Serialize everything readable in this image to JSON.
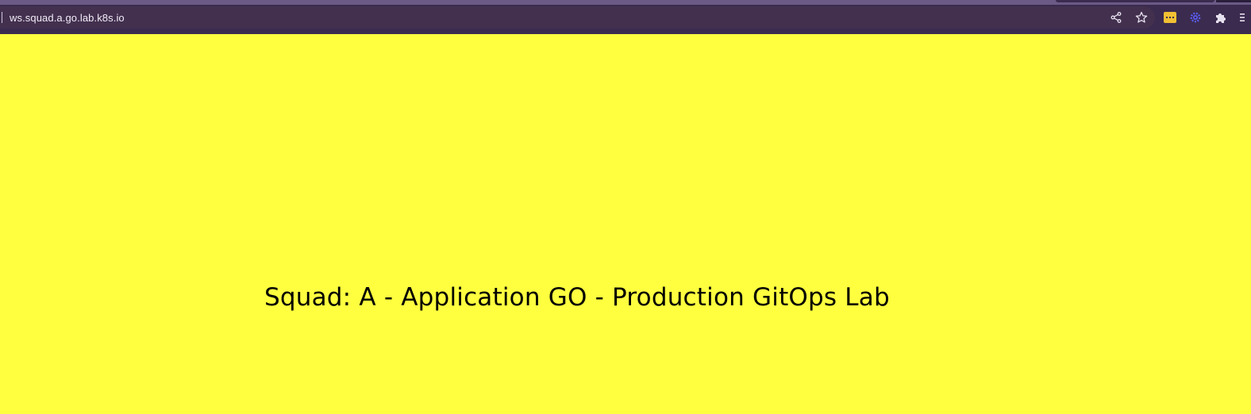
{
  "browser": {
    "url": "ws.squad.a.go.lab.k8s.io",
    "omnibox_icons": [
      "share-icon",
      "bookmark-star-icon"
    ],
    "extension_icons": [
      "password-manager-extension-icon",
      "gear-extension-icon",
      "extensions-puzzle-icon",
      "menu-icon"
    ],
    "colors": {
      "chrome_bg": "#3b2b4f",
      "omnibox_bg": "#43304f",
      "strip": "#6b5a86"
    }
  },
  "page": {
    "heading": "Squad: A - Application GO - Production GitOps Lab",
    "background_color": "#ffff40",
    "text_color": "#000000"
  }
}
